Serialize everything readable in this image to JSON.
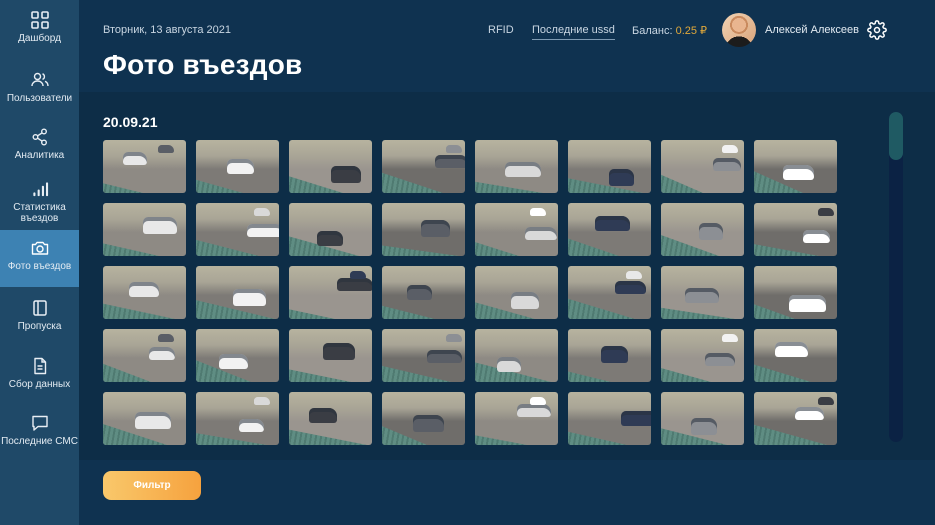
{
  "sidebar": {
    "items": [
      {
        "label": "Дашборд",
        "icon": "grid-icon",
        "active": false
      },
      {
        "label": "Пользователи",
        "icon": "users-icon",
        "active": false
      },
      {
        "label": "Аналитика",
        "icon": "share-icon",
        "active": false
      },
      {
        "label": "Статистика въездов",
        "icon": "bar-chart-icon",
        "active": false
      },
      {
        "label": "Фото въездов",
        "icon": "camera-icon",
        "active": true
      },
      {
        "label": "Пропуска",
        "icon": "pass-icon",
        "active": false
      },
      {
        "label": "Сбор данных",
        "icon": "document-icon",
        "active": false
      },
      {
        "label": "Последние СМС",
        "icon": "message-icon",
        "active": false
      }
    ]
  },
  "header": {
    "date": "Вторник, 13 августа 2021",
    "title": "Фото въездов",
    "rfid_label": "RFID",
    "ussd_label": "Последние ussd",
    "balance_label": "Баланс:",
    "balance_value": "0.25 ₽",
    "user_name": "Алексей Алексеев"
  },
  "gallery": {
    "section_date": "20.09.21",
    "photo_count": 40
  },
  "footer": {
    "filter_label": "Фильтр"
  },
  "colors": {
    "sidebar_bg": "#1f4968",
    "sidebar_active": "#3d82b3",
    "page_bg": "#0d2d47",
    "accent_orange": "#f6a23e",
    "balance_amount": "#e0a83a"
  }
}
